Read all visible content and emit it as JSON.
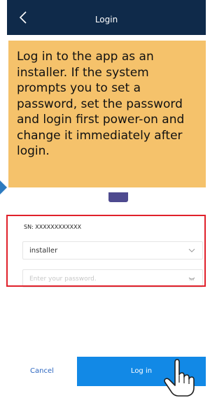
{
  "header": {
    "title": "Login"
  },
  "callout": {
    "text": "Log in to the app as an installer. If the system prompts you to set a password, set the password and login first power-on and change it immediately after login."
  },
  "form": {
    "sn_label": "SN: XXXXXXXXXXXX",
    "username_value": "installer",
    "password_placeholder": "Enter your password."
  },
  "footer": {
    "cancel_label": "Cancel",
    "login_label": "Log in"
  },
  "icons": {
    "back": "chevron-left-icon",
    "dropdown": "chevron-down-icon",
    "visibility": "eye-closed-icon",
    "pointer": "hand-pointer-icon"
  },
  "colors": {
    "header": "#0f2a4a",
    "callout": "#f5c26b",
    "highlight_frame": "#e0212b",
    "primary": "#1289e6",
    "cancel_text": "#2d67c1"
  }
}
